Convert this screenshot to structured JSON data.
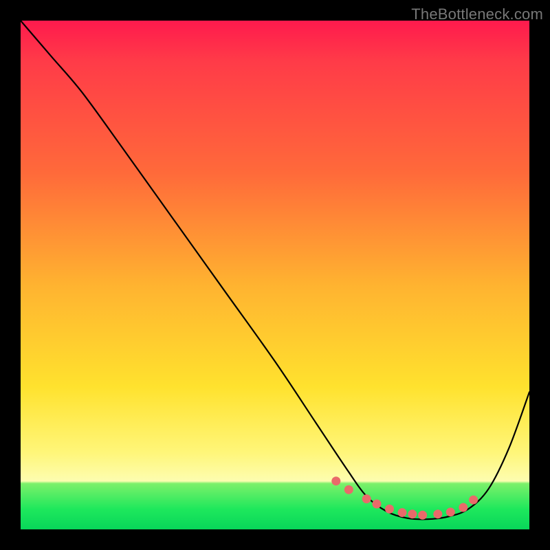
{
  "watermark": "TheBottleneck.com",
  "chart_data": {
    "type": "line",
    "title": "",
    "xlabel": "",
    "ylabel": "",
    "xlim": [
      0,
      100
    ],
    "ylim": [
      0,
      100
    ],
    "series": [
      {
        "name": "curve",
        "x": [
          0,
          6,
          12,
          20,
          30,
          40,
          50,
          58,
          64,
          68,
          72,
          76,
          80,
          84,
          88,
          92,
          96,
          100
        ],
        "y": [
          100,
          93,
          86,
          75,
          61,
          47,
          33,
          21,
          12,
          6.5,
          3.5,
          2.2,
          2.0,
          2.5,
          4.0,
          8,
          16,
          27
        ]
      }
    ],
    "markers": {
      "name": "dots",
      "color": "#e96a6a",
      "x": [
        62,
        64.5,
        68,
        70,
        72.5,
        75,
        77,
        79,
        82,
        84.5,
        87,
        89
      ],
      "y": [
        9.5,
        7.8,
        6.0,
        5.0,
        4.0,
        3.3,
        3.0,
        2.8,
        3.0,
        3.4,
        4.3,
        5.8
      ]
    }
  }
}
